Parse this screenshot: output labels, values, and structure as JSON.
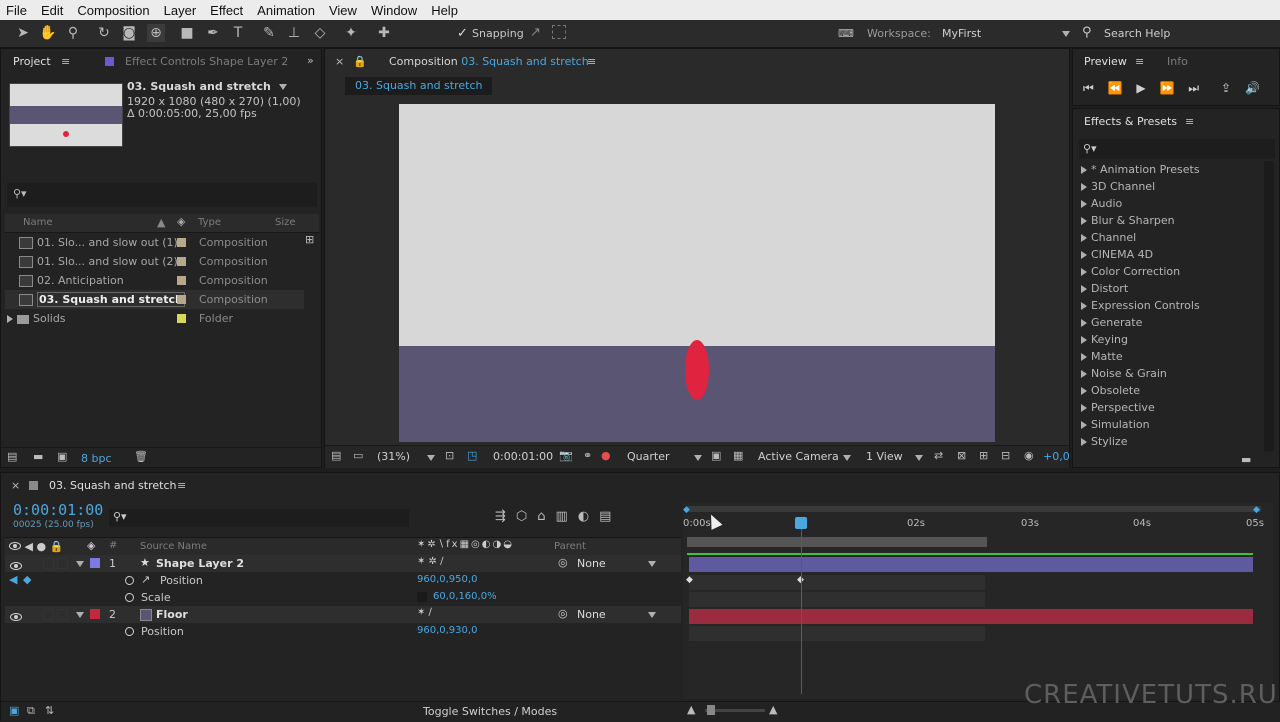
{
  "menu": [
    "File",
    "Edit",
    "Composition",
    "Layer",
    "Effect",
    "Animation",
    "View",
    "Window",
    "Help"
  ],
  "toolbar": {
    "snapping_label": "Snapping",
    "workspace_label": "Workspace:",
    "workspace_value": "MyFirst",
    "search_help": "Search Help"
  },
  "project": {
    "tab_label": "Project",
    "effect_controls_tab": "Effect Controls Shape Layer 2",
    "comp_name": "03. Squash and stretch",
    "comp_dims": "1920 x 1080  (480 x 270) (1,00)",
    "comp_duration": "Δ 0:00:05:00, 25,00 fps",
    "columns": [
      "Name",
      "Type",
      "Size"
    ],
    "items": [
      {
        "name": "01. Slo... and slow out (1)",
        "type": "Composition"
      },
      {
        "name": "01. Slo... and slow out (2)",
        "type": "Composition"
      },
      {
        "name": "02. Anticipation",
        "type": "Composition"
      },
      {
        "name": "03. Squash and stretch",
        "type": "Composition"
      },
      {
        "name": "Solids",
        "type": "Folder"
      }
    ],
    "bpc": "8 bpc"
  },
  "composition": {
    "tab_prefix": "Composition",
    "tab_name": "03. Squash and stretch",
    "sub_tab": "03. Squash and stretch",
    "zoom": "(31%)",
    "timecode": "0:00:01:00",
    "resolution": "Quarter",
    "camera": "Active Camera",
    "views": "1 View",
    "exposure": "+0,0",
    "colors": {
      "sky": "#d7d7d7",
      "floor": "#5b5574",
      "ball": "#e0233f"
    }
  },
  "preview": {
    "tab_label": "Preview",
    "info_tab": "Info"
  },
  "effects": {
    "tab_label": "Effects & Presets",
    "items": [
      "* Animation Presets",
      "3D Channel",
      "Audio",
      "Blur & Sharpen",
      "Channel",
      "CINEMA 4D",
      "Color Correction",
      "Distort",
      "Expression Controls",
      "Generate",
      "Keying",
      "Matte",
      "Noise & Grain",
      "Obsolete",
      "Perspective",
      "Simulation",
      "Stylize"
    ]
  },
  "timeline": {
    "tab_name": "03. Squash and stretch",
    "timecode": "0:00:01:00",
    "frame_info": "00025 (25.00 fps)",
    "col_source": "Source Name",
    "col_parent": "Parent",
    "ruler": [
      "0:00s",
      "02s",
      "03s",
      "04s",
      "05s"
    ],
    "layers": [
      {
        "num": "1",
        "name": "Shape Layer 2",
        "parent": "None",
        "color": "#7a7ae0",
        "bar_color": "#5f5aa0"
      },
      {
        "num": "2",
        "name": "Floor",
        "parent": "None",
        "color": "#c4283f",
        "bar_color": "#9b2c3f"
      }
    ],
    "props": [
      {
        "label": "Position",
        "value": "960,0,950,0"
      },
      {
        "label": "Scale",
        "value": "60,0,160,0%"
      },
      {
        "label": "Position",
        "value": "960,0,930,0"
      }
    ],
    "toggle_label": "Toggle Switches / Modes"
  },
  "watermark": "CREATIVETUTS.RU"
}
